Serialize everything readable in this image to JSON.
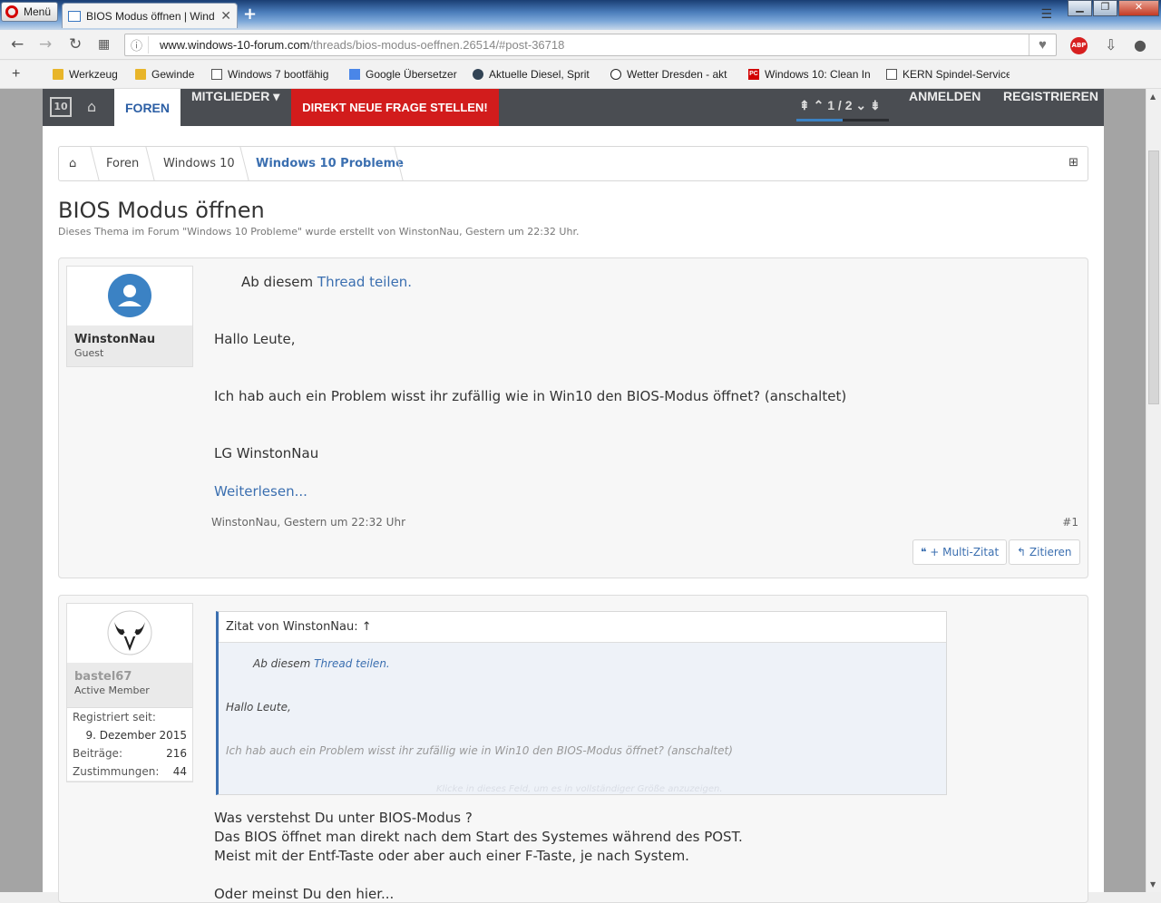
{
  "browser": {
    "menu_label": "Menü",
    "tab_title": "BIOS Modus öffnen | Wind",
    "url_domain": "www.windows-10-forum.com",
    "url_path": "/threads/bios-modus-oeffnen.26514/#post-36718",
    "abp_label": "ABP",
    "bookmarks": [
      "Werkzeug",
      "Gewinde",
      "Windows 7 bootfähig",
      "Google Übersetzer",
      "Aktuelle Diesel, Sprit",
      "Wetter Dresden - akt",
      "Windows 10: Clean In",
      "KERN Spindel-Service"
    ]
  },
  "nav": {
    "logo": "10",
    "foren": "FOREN",
    "mitglieder": "MITGLIEDER ▾",
    "direkt": "DIREKT NEUE FRAGE STELLEN!",
    "pager": "1 / 2",
    "anmelden": "ANMELDEN",
    "registrieren": "REGISTRIEREN",
    "page_fraction": 0.5
  },
  "breadcrumb": [
    "Foren",
    "Windows 10",
    "Windows 10 Probleme"
  ],
  "thread": {
    "title": "BIOS Modus öffnen",
    "subtitle": "Dieses Thema im Forum \"Windows 10 Probleme\" wurde erstellt von WinstonNau, Gestern um 22:32 Uhr."
  },
  "post1": {
    "author": "WinstonNau",
    "role": "Guest",
    "share_prefix": "Ab diesem",
    "share_link": "Thread teilen.",
    "greeting": "Hallo Leute,",
    "body": "Ich hab auch ein Problem wisst ihr zufällig wie in Win10 den BIOS-Modus öffnet? (anschaltet)",
    "signoff": "LG WinstonNau",
    "read_more": "Weiterlesen...",
    "meta": "WinstonNau, Gestern um 22:32 Uhr",
    "number": "#1",
    "multi_quote": "+ Multi-Zitat",
    "quote_btn": "Zitieren"
  },
  "post2": {
    "author": "bastel67",
    "role": "Active Member",
    "stats": [
      {
        "label": "Registriert seit:",
        "value": ""
      },
      {
        "label": "",
        "value": "9. Dezember 2015"
      },
      {
        "label": "Beiträge:",
        "value": "216"
      },
      {
        "label": "Zustimmungen:",
        "value": "44"
      }
    ],
    "quote_head": "Zitat von WinstonNau: ↑",
    "quote_share_prefix": "Ab diesem",
    "quote_share_link": "Thread teilen.",
    "quote_greeting": "Hallo Leute,",
    "quote_body": "Ich hab auch ein Problem wisst ihr zufällig wie in Win10 den BIOS-Modus öffnet? (anschaltet)",
    "quote_expand": "Klicke in dieses Feld, um es in vollständiger Größe anzuzeigen.",
    "line1": "Was verstehst Du unter BIOS-Modus ?",
    "line2": "Das BIOS öffnet man direkt nach dem Start des Systemes während des POST.",
    "line3": "Meist mit der Entf-Taste oder aber auch einer F-Taste, je nach System.",
    "line4": "Oder meinst Du den hier..."
  }
}
